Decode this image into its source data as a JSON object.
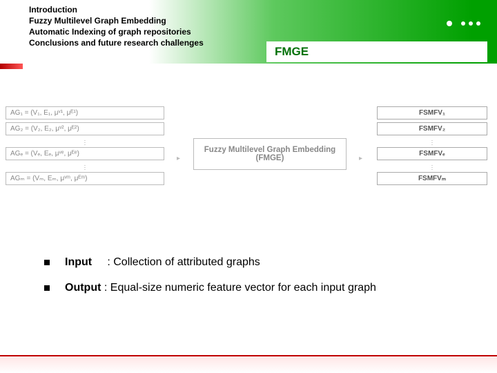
{
  "outline": {
    "l1": "Introduction",
    "l2": "Fuzzy Multilevel Graph Embedding",
    "l3": "Automatic Indexing of graph repositories",
    "l4": "Conclusions and future research challenges"
  },
  "section": "FMGE",
  "diagram": {
    "ag1": "AG₁ = (V₁, E₁, μᵛ¹, μᴱ¹)",
    "ag2": "AG₂ = (V₂, E₂, μᵛ², μᴱ²)",
    "age": "AGₑ = (Vₑ, Eₑ, μᵛᵉ, μᴱᵉ)",
    "agm": "AGₘ = (Vₘ, Eₘ, μᵛᵐ, μᴱᵐ)",
    "center_line1": "Fuzzy Multilevel Graph Embedding",
    "center_line2": "(FMGE)",
    "fv1": "FSMFV₁",
    "fv2": "FSMFV₂",
    "fve": "FSMFVₑ",
    "fvm": "FSMFVₘ"
  },
  "bullets": {
    "input_label": "Input",
    "input_text": ": Collection of attributed graphs",
    "output_label": "Output",
    "output_text": ": Equal-size numeric feature vector for each input graph"
  }
}
